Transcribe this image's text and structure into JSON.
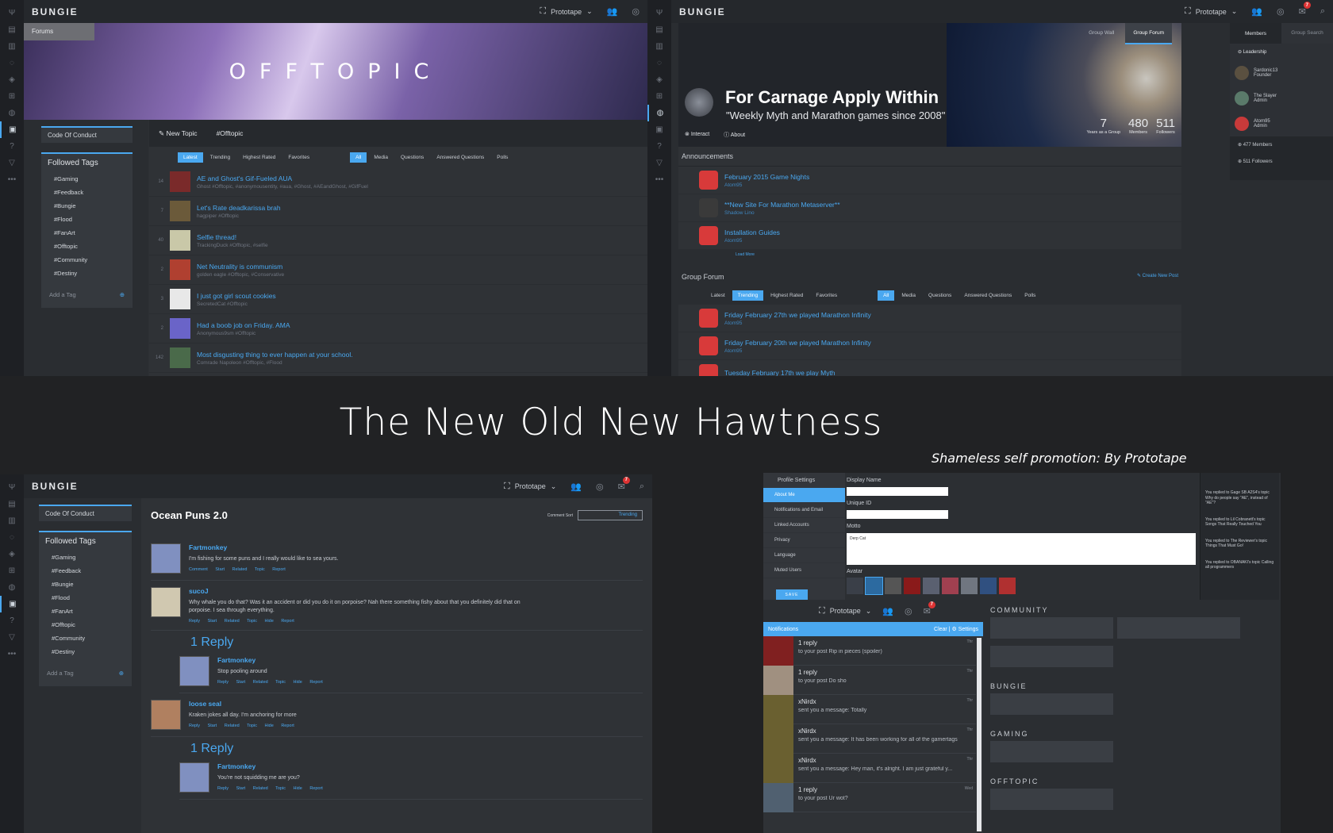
{
  "headline": {
    "title": "The New Old New Hawtness",
    "subtitle": "Shameless self promotion: By Prototape"
  },
  "colors": {
    "accent": "#4aa8f0",
    "bg": "#212224",
    "panel": "#2d3034",
    "badge": "#dd3333"
  },
  "topbar": {
    "logo": "BUNGIE",
    "user": "Prototape",
    "notif_count": "7"
  },
  "iconbar": [
    "hamburger-icon",
    "news-icon",
    "media-icon",
    "pulse-icon",
    "layers-icon",
    "store-icon",
    "groups-icon",
    "forums-icon",
    "help-icon",
    "destiny-icon",
    "more-icon"
  ],
  "forum": {
    "crumb": "Forums",
    "banner": "OFFTOPIC",
    "new_topic": "New Topic",
    "tag": "#Offtopic",
    "coc": "Code Of Conduct",
    "followed_title": "Followed Tags",
    "tags": [
      "#Gaming",
      "#Feedback",
      "#Bungie",
      "#Flood",
      "#FanArt",
      "#Offtopic",
      "#Community",
      "#Destiny"
    ],
    "add_tag": "Add a Tag",
    "sorts": [
      "Latest",
      "Trending",
      "Highest Rated",
      "Favorites"
    ],
    "filters": [
      "All",
      "Media",
      "Questions",
      "Answered Questions",
      "Polls"
    ],
    "topics": [
      {
        "n": "14",
        "title": "AE and Ghost's Gif-Fueled AUA",
        "sub": "Ghost #Offtopic, #anonymousentity, #aua, #Ghost, #AEandGhost, #GifFuel"
      },
      {
        "n": "7",
        "title": "Let's Rate deadkarissa brah",
        "sub": "hagpiper #Offtopic"
      },
      {
        "n": "40",
        "title": "Selfie thread!",
        "sub": "TrackingDuck #Offtopic, #selfie"
      },
      {
        "n": "2",
        "title": "Net Neutrality is communism",
        "sub": "golden eagle #Offtopic, #Conservative"
      },
      {
        "n": "3",
        "title": "I just got girl scout cookies",
        "sub": "SecretedCat #Offtopic"
      },
      {
        "n": "2",
        "title": "Had a boob job on Friday. AMA",
        "sub": "Anonymous9sm #Offtopic"
      },
      {
        "n": "142",
        "title": "Most disgusting thing to ever happen at your school.",
        "sub": "Comrade Napoleon #Offtopic, #Flood"
      }
    ]
  },
  "group": {
    "tabs": [
      "Group Wall",
      "Group Forum"
    ],
    "side_tabs": [
      "Members",
      "Group Search"
    ],
    "name": "For Carnage Apply Within",
    "tagline": "\"Weekly Myth and Marathon games since 2008\"",
    "actions": [
      "Interact",
      "About"
    ],
    "stats": [
      {
        "v": "7",
        "l": "Years as a Group"
      },
      {
        "v": "480",
        "l": "Members"
      },
      {
        "v": "511",
        "l": "Followers"
      }
    ],
    "leadership": "Leadership",
    "leaders": [
      {
        "n": "Sardonic13",
        "r": "Founder"
      },
      {
        "n": "The Slayer",
        "r": "Admin"
      },
      {
        "n": "Atom95",
        "r": "Admin"
      }
    ],
    "member_count": "477 Members",
    "follower_count": "511 Followers",
    "ann_title": "Announcements",
    "announcements": [
      {
        "t": "February 2015 Game Nights",
        "s": "Atom95"
      },
      {
        "t": "**New Site For Marathon Metaserver**",
        "s": "Shadow Lino"
      },
      {
        "t": "Installation Guides",
        "s": "Atom95"
      }
    ],
    "load_more": "Load More",
    "forum_title": "Group Forum",
    "create": "Create New Post",
    "posts": [
      {
        "t": "Friday February 27th we played Marathon Infinity",
        "s": "Atom95"
      },
      {
        "t": "Friday February 20th we played Marathon Infinity",
        "s": "Atom95"
      },
      {
        "t": "Tuesday February 17th we play Myth",
        "s": ""
      }
    ]
  },
  "thread": {
    "title": "Ocean Puns 2.0",
    "sort_label": "Comment Sort",
    "sort_value": "Trending",
    "comments": [
      {
        "n": "Fartmonkey",
        "b": "I'm fishing for some puns and I really would like to sea yours.",
        "a": "Comment Start Related Topic Report",
        "l": 0
      },
      {
        "n": "sucoJ",
        "b": "Why whale you do that? Was it an accident or did you do it on porpoise? Nah there something fishy about that you definitely did that on porpoise. I sea through everything.",
        "a": "Reply Start Related Topic Hide Report",
        "l": 0
      },
      {
        "n": "Fartmonkey",
        "b": "Stop pooling around",
        "a": "Reply Start Related Topic Hide Report",
        "l": 1
      },
      {
        "n": "loose seal",
        "b": "Kraken jokes all day. I'm anchoring for more",
        "a": "Reply Start Related Topic Hide Report",
        "l": 0
      },
      {
        "n": "Fartmonkey",
        "b": "You're not squidding me are you?",
        "a": "Reply Start Related Topic Hide Report",
        "l": 1
      }
    ],
    "reply": "1 Reply"
  },
  "settings": {
    "header": "Profile Settings",
    "nav": [
      "About Me",
      "Notifications and Email",
      "Linked Accounts",
      "Privacy",
      "Language",
      "Muted Users"
    ],
    "display_name": "Display Name",
    "unique_id": "Unique ID",
    "motto": "Motto",
    "motto_value": "Derp Cat",
    "avatar": "Avatar",
    "save": "SAVE",
    "activity": [
      "You replied to Gage SB A2S4's topic Why do people say \"AE\", instead of \"AE\"?",
      "You replied to Lil Cobranett's topic Songs That Really Touched You",
      "You replied to The Reviewer's topic Things That Must Go!",
      "You replied to OBANAKI's topic Calling all programmers"
    ],
    "notif_title": "Notifications",
    "clear": "Clear",
    "settings_link": "Settings",
    "notifs": [
      {
        "a": "1 reply",
        "b": "to your post Rip in pieces (spoiler)",
        "w": "Thr"
      },
      {
        "a": "1 reply",
        "b": "to your post Do sho",
        "w": "Thr"
      },
      {
        "a": "xNirdx",
        "b": "sent you a message: Totally",
        "w": "Thr"
      },
      {
        "a": "xNirdx",
        "b": "sent you a message: It has been working for all of the gamertags th...",
        "w": "Thr"
      },
      {
        "a": "xNirdx",
        "b": "sent you a message: Hey man, it's alright. I am just grateful y...",
        "w": "Thr"
      },
      {
        "a": "1 reply",
        "b": "to your post Ur wot?",
        "w": "Wed"
      }
    ],
    "groups": [
      "COMMUNITY",
      "BUNGIE",
      "GAMING",
      "OFFTOPIC"
    ]
  }
}
